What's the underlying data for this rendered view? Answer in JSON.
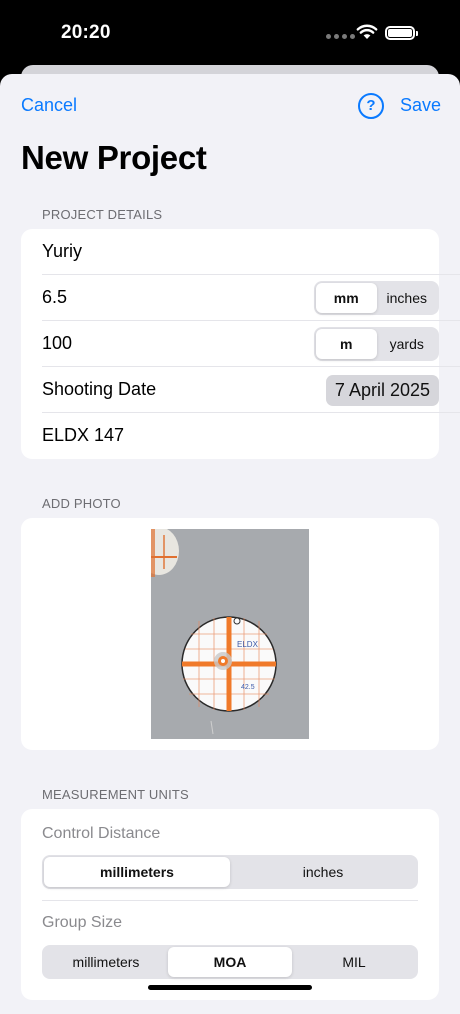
{
  "status_bar": {
    "time": "20:20"
  },
  "nav": {
    "cancel_label": "Cancel",
    "help_label": "?",
    "save_label": "Save"
  },
  "title": "New Project",
  "project_details": {
    "header": "PROJECT DETAILS",
    "name": "Yuriy",
    "caliber": {
      "value": "6.5",
      "units": [
        "mm",
        "inches"
      ],
      "selected": "mm"
    },
    "distance": {
      "value": "100",
      "units": [
        "m",
        "yards"
      ],
      "selected": "m"
    },
    "shooting_date": {
      "label": "Shooting Date",
      "value": "7 April 2025"
    },
    "ammo": "ELDX 147"
  },
  "add_photo": {
    "header": "ADD PHOTO"
  },
  "measurement_units": {
    "header": "MEASUREMENT UNITS",
    "control_distance": {
      "label": "Control Distance",
      "options": [
        "millimeters",
        "inches"
      ],
      "selected": "millimeters"
    },
    "group_size": {
      "label": "Group Size",
      "options": [
        "millimeters",
        "MOA",
        "MIL"
      ],
      "selected": "MOA"
    }
  },
  "colors": {
    "accent": "#0a7aff",
    "background": "#f2f2f7",
    "target_orange": "#f07a2a"
  }
}
